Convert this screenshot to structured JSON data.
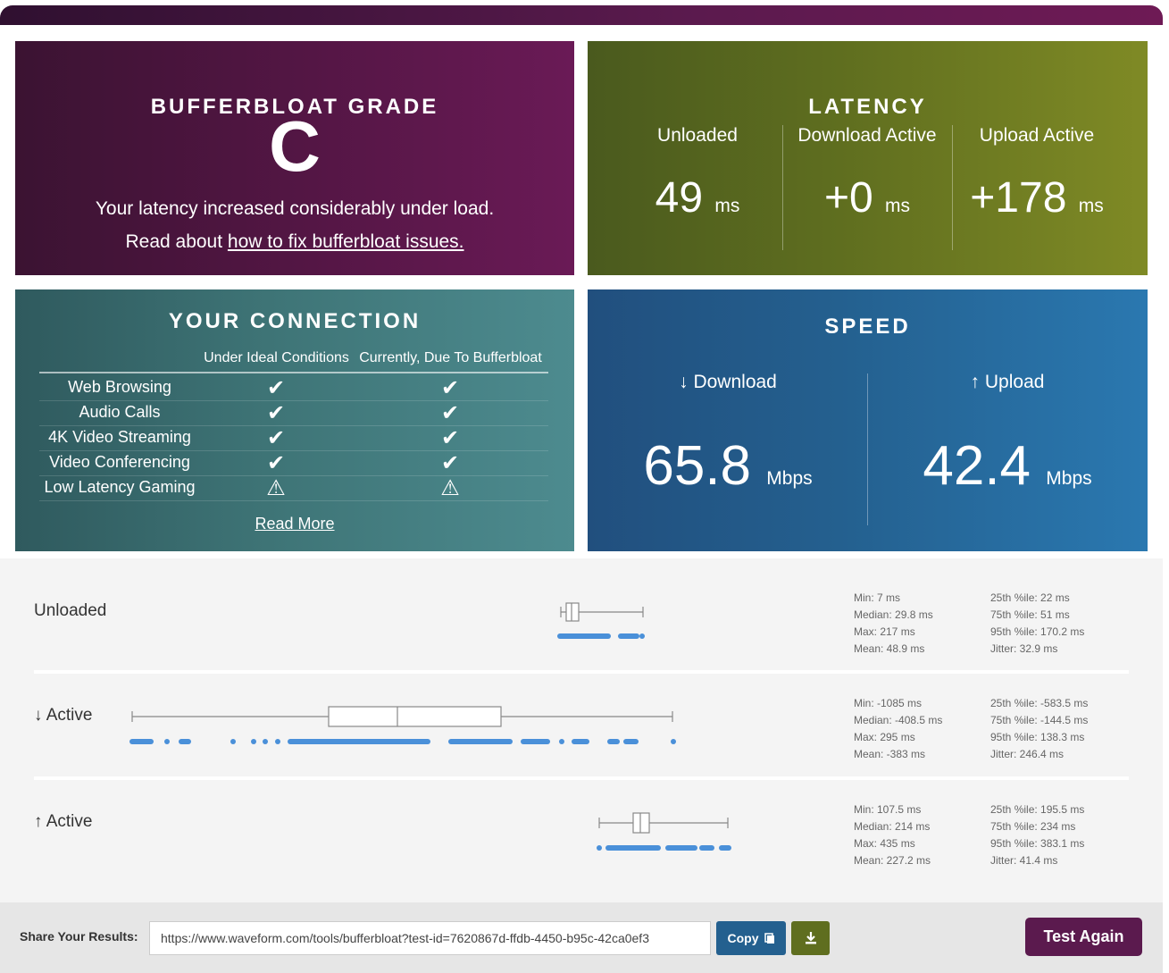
{
  "grade": {
    "title": "BUFFERBLOAT GRADE",
    "letter": "C",
    "message": "Your latency increased considerably under load.",
    "read_prefix": "Read about ",
    "read_link": "how to fix bufferbloat issues."
  },
  "latency": {
    "title": "LATENCY",
    "cols": [
      {
        "label": "Unloaded",
        "value": "49",
        "unit": "ms"
      },
      {
        "label": "Download Active",
        "value": "+0",
        "unit": "ms"
      },
      {
        "label": "Upload Active",
        "value": "+178",
        "unit": "ms"
      }
    ]
  },
  "connection": {
    "title": "YOUR CONNECTION",
    "col1": "Under Ideal Conditions",
    "col2": "Currently, Due To Bufferbloat",
    "rows": [
      {
        "name": "Web Browsing",
        "ideal": "check",
        "current": "check"
      },
      {
        "name": "Audio Calls",
        "ideal": "check",
        "current": "check"
      },
      {
        "name": "4K Video Streaming",
        "ideal": "check",
        "current": "check"
      },
      {
        "name": "Video Conferencing",
        "ideal": "check",
        "current": "check"
      },
      {
        "name": "Low Latency Gaming",
        "ideal": "warning",
        "current": "warning"
      }
    ],
    "read_more": "Read More"
  },
  "speed": {
    "title": "SPEED",
    "download_label": "↓ Download",
    "download_value": "65.8",
    "upload_label": "↑ Upload",
    "upload_value": "42.4",
    "unit": "Mbps"
  },
  "details": {
    "rows": [
      {
        "label": "Unloaded",
        "stats_left": [
          "Min: 7 ms",
          "Median: 29.8 ms",
          "Max: 217 ms",
          "Mean: 48.9 ms"
        ],
        "stats_right": [
          "25th %ile: 22 ms",
          "75th %ile: 51 ms",
          "95th %ile: 170.2 ms",
          "Jitter: 32.9 ms"
        ]
      },
      {
        "label": "↓ Active",
        "stats_left": [
          "Min: -1085 ms",
          "Median: -408.5 ms",
          "Max: 295 ms",
          "Mean: -383 ms"
        ],
        "stats_right": [
          "25th %ile: -583.5 ms",
          "75th %ile: -144.5 ms",
          "95th %ile: 138.3 ms",
          "Jitter: 246.4 ms"
        ]
      },
      {
        "label": "↑ Active",
        "stats_left": [
          "Min: 107.5 ms",
          "Median: 214 ms",
          "Max: 435 ms",
          "Mean: 227.2 ms"
        ],
        "stats_right": [
          "25th %ile: 195.5 ms",
          "75th %ile: 234 ms",
          "95th %ile: 383.1 ms",
          "Jitter: 41.4 ms"
        ]
      }
    ]
  },
  "share": {
    "label": "Share Your Results:",
    "url": "https://www.waveform.com/tools/bufferbloat?test-id=7620867d-ffdb-4450-b95c-42ca0ef3",
    "copy_label": "Copy",
    "test_again_label": "Test Again"
  },
  "colors": {
    "grade_bg": "#4e1540",
    "latency_bg": "#5f6e1f",
    "connection_bg": "#3e7476",
    "speed_bg": "#24608f",
    "dot_color": "#4a90d9",
    "test_again_bg": "#5b1a4e"
  }
}
